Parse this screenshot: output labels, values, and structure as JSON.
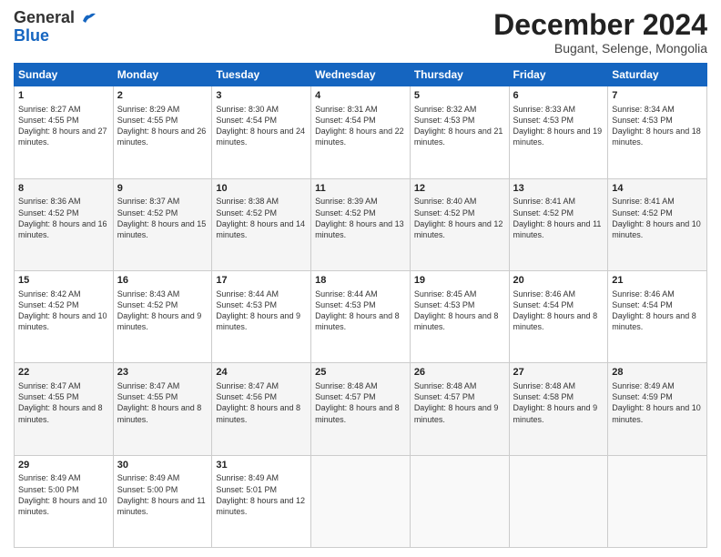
{
  "logo": {
    "line1": "General",
    "line2": "Blue"
  },
  "header": {
    "month": "December 2024",
    "location": "Bugant, Selenge, Mongolia"
  },
  "weekdays": [
    "Sunday",
    "Monday",
    "Tuesday",
    "Wednesday",
    "Thursday",
    "Friday",
    "Saturday"
  ],
  "weeks": [
    [
      {
        "day": "1",
        "sunrise": "8:27 AM",
        "sunset": "4:55 PM",
        "daylight": "8 hours and 27 minutes."
      },
      {
        "day": "2",
        "sunrise": "8:29 AM",
        "sunset": "4:55 PM",
        "daylight": "8 hours and 26 minutes."
      },
      {
        "day": "3",
        "sunrise": "8:30 AM",
        "sunset": "4:54 PM",
        "daylight": "8 hours and 24 minutes."
      },
      {
        "day": "4",
        "sunrise": "8:31 AM",
        "sunset": "4:54 PM",
        "daylight": "8 hours and 22 minutes."
      },
      {
        "day": "5",
        "sunrise": "8:32 AM",
        "sunset": "4:53 PM",
        "daylight": "8 hours and 21 minutes."
      },
      {
        "day": "6",
        "sunrise": "8:33 AM",
        "sunset": "4:53 PM",
        "daylight": "8 hours and 19 minutes."
      },
      {
        "day": "7",
        "sunrise": "8:34 AM",
        "sunset": "4:53 PM",
        "daylight": "8 hours and 18 minutes."
      }
    ],
    [
      {
        "day": "8",
        "sunrise": "8:36 AM",
        "sunset": "4:52 PM",
        "daylight": "8 hours and 16 minutes."
      },
      {
        "day": "9",
        "sunrise": "8:37 AM",
        "sunset": "4:52 PM",
        "daylight": "8 hours and 15 minutes."
      },
      {
        "day": "10",
        "sunrise": "8:38 AM",
        "sunset": "4:52 PM",
        "daylight": "8 hours and 14 minutes."
      },
      {
        "day": "11",
        "sunrise": "8:39 AM",
        "sunset": "4:52 PM",
        "daylight": "8 hours and 13 minutes."
      },
      {
        "day": "12",
        "sunrise": "8:40 AM",
        "sunset": "4:52 PM",
        "daylight": "8 hours and 12 minutes."
      },
      {
        "day": "13",
        "sunrise": "8:41 AM",
        "sunset": "4:52 PM",
        "daylight": "8 hours and 11 minutes."
      },
      {
        "day": "14",
        "sunrise": "8:41 AM",
        "sunset": "4:52 PM",
        "daylight": "8 hours and 10 minutes."
      }
    ],
    [
      {
        "day": "15",
        "sunrise": "8:42 AM",
        "sunset": "4:52 PM",
        "daylight": "8 hours and 10 minutes."
      },
      {
        "day": "16",
        "sunrise": "8:43 AM",
        "sunset": "4:52 PM",
        "daylight": "8 hours and 9 minutes."
      },
      {
        "day": "17",
        "sunrise": "8:44 AM",
        "sunset": "4:53 PM",
        "daylight": "8 hours and 9 minutes."
      },
      {
        "day": "18",
        "sunrise": "8:44 AM",
        "sunset": "4:53 PM",
        "daylight": "8 hours and 8 minutes."
      },
      {
        "day": "19",
        "sunrise": "8:45 AM",
        "sunset": "4:53 PM",
        "daylight": "8 hours and 8 minutes."
      },
      {
        "day": "20",
        "sunrise": "8:46 AM",
        "sunset": "4:54 PM",
        "daylight": "8 hours and 8 minutes."
      },
      {
        "day": "21",
        "sunrise": "8:46 AM",
        "sunset": "4:54 PM",
        "daylight": "8 hours and 8 minutes."
      }
    ],
    [
      {
        "day": "22",
        "sunrise": "8:47 AM",
        "sunset": "4:55 PM",
        "daylight": "8 hours and 8 minutes."
      },
      {
        "day": "23",
        "sunrise": "8:47 AM",
        "sunset": "4:55 PM",
        "daylight": "8 hours and 8 minutes."
      },
      {
        "day": "24",
        "sunrise": "8:47 AM",
        "sunset": "4:56 PM",
        "daylight": "8 hours and 8 minutes."
      },
      {
        "day": "25",
        "sunrise": "8:48 AM",
        "sunset": "4:57 PM",
        "daylight": "8 hours and 8 minutes."
      },
      {
        "day": "26",
        "sunrise": "8:48 AM",
        "sunset": "4:57 PM",
        "daylight": "8 hours and 9 minutes."
      },
      {
        "day": "27",
        "sunrise": "8:48 AM",
        "sunset": "4:58 PM",
        "daylight": "8 hours and 9 minutes."
      },
      {
        "day": "28",
        "sunrise": "8:49 AM",
        "sunset": "4:59 PM",
        "daylight": "8 hours and 10 minutes."
      }
    ],
    [
      {
        "day": "29",
        "sunrise": "8:49 AM",
        "sunset": "5:00 PM",
        "daylight": "8 hours and 10 minutes."
      },
      {
        "day": "30",
        "sunrise": "8:49 AM",
        "sunset": "5:00 PM",
        "daylight": "8 hours and 11 minutes."
      },
      {
        "day": "31",
        "sunrise": "8:49 AM",
        "sunset": "5:01 PM",
        "daylight": "8 hours and 12 minutes."
      },
      null,
      null,
      null,
      null
    ]
  ]
}
